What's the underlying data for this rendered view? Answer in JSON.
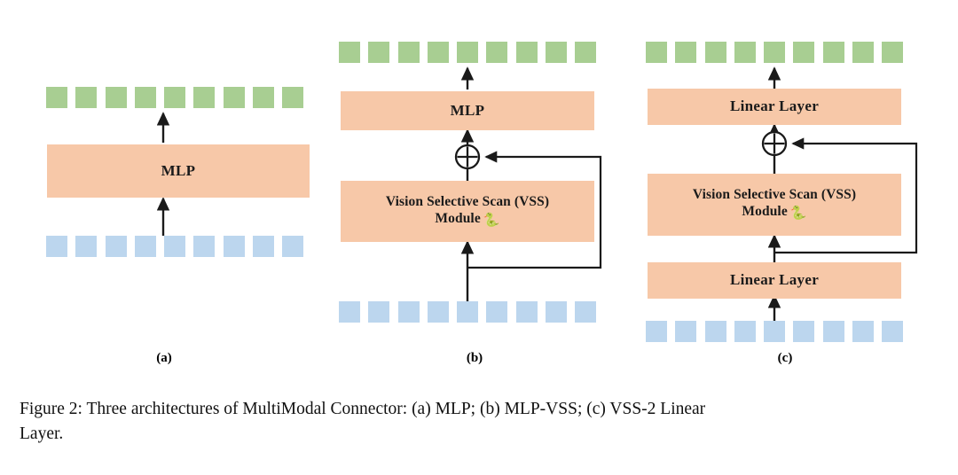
{
  "figure": {
    "caption_line_1": "Figure 2: Three architectures of MultiModal Connector: (a) MLP; (b) MLP-VSS; (c) VSS-2 Linear",
    "caption_line_2": "Layer."
  },
  "colors": {
    "input_token": "#bcd6ee",
    "output_token": "#a8ce92",
    "module_box": "#f7c8a8",
    "wire": "#1a1a1a",
    "background": "#ffffff"
  },
  "panels": [
    {
      "id": "a",
      "label": "(a)",
      "output_tokens": 9,
      "input_tokens": 9,
      "modules": [
        {
          "name": "mlp",
          "label": "MLP"
        }
      ],
      "has_residual": false
    },
    {
      "id": "b",
      "label": "(b)",
      "output_tokens": 9,
      "input_tokens": 9,
      "modules": [
        {
          "name": "mlp",
          "label": "MLP"
        },
        {
          "name": "vss",
          "label_line_1": "Vision Selective Scan (VSS)",
          "label_line_2": "Module",
          "icon": "snake-icon"
        }
      ],
      "has_residual": true,
      "residual_operator": "⊕"
    },
    {
      "id": "c",
      "label": "(c)",
      "output_tokens": 9,
      "input_tokens": 9,
      "modules": [
        {
          "name": "linear-top",
          "label": "Linear Layer"
        },
        {
          "name": "vss",
          "label_line_1": "Vision Selective Scan (VSS)",
          "label_line_2": "Module",
          "icon": "snake-icon"
        },
        {
          "name": "linear-bottom",
          "label": "Linear Layer"
        }
      ],
      "has_residual": true,
      "residual_operator": "⊕"
    }
  ]
}
